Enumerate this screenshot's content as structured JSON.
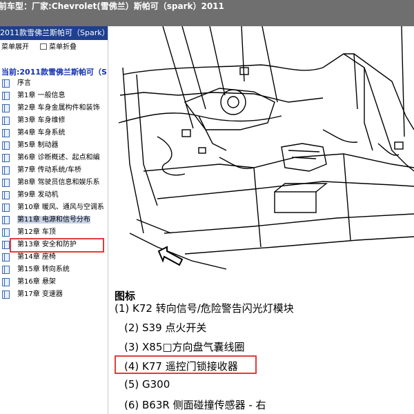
{
  "app": {
    "title": "前车型：厂家:Chevrolet(雪佛兰）斯帕可（spark）2011"
  },
  "sidebar": {
    "header": "2011款雪佛兰斯帕可（Spark）维",
    "toolbar": {
      "expand_label": "菜单展开",
      "collapse_label": "菜单折叠"
    },
    "current": "当前:2011款雪佛兰斯帕可（S",
    "items": [
      {
        "label": "序言"
      },
      {
        "label": "第1章 一般信息"
      },
      {
        "label": "第2章 车身金属构件和装饰"
      },
      {
        "label": "第3章 车身维修"
      },
      {
        "label": "第4章 车身系统"
      },
      {
        "label": "第5章 制动器"
      },
      {
        "label": "第6章 诊断概述、起点和编"
      },
      {
        "label": "第7章 传动系统/车桥"
      },
      {
        "label": "第8章 驾驶员信息和娱乐系"
      },
      {
        "label": "第9章 发动机"
      },
      {
        "label": "第10章 暖风、通风与空调系"
      },
      {
        "label": "第11章 电源和信号分布",
        "selected": true
      },
      {
        "label": "第12章 车顶"
      },
      {
        "label": "第13章 安全和防护"
      },
      {
        "label": "第14章 座椅"
      },
      {
        "label": "第15章 转向系统"
      },
      {
        "label": "第16章 悬架"
      },
      {
        "label": "第17章 变速器"
      }
    ]
  },
  "main": {
    "legend_title": "图标",
    "legend": [
      "(1) K72 转向信号/危险警告闪光灯模块",
      "(2) S39 点火开关",
      "(3) X85□方向盘气囊线圈",
      "(4) K77 遥控门锁接收器",
      "(5) G300",
      "(6) B63R 侧面碰撞传感器 - 右"
    ]
  }
}
